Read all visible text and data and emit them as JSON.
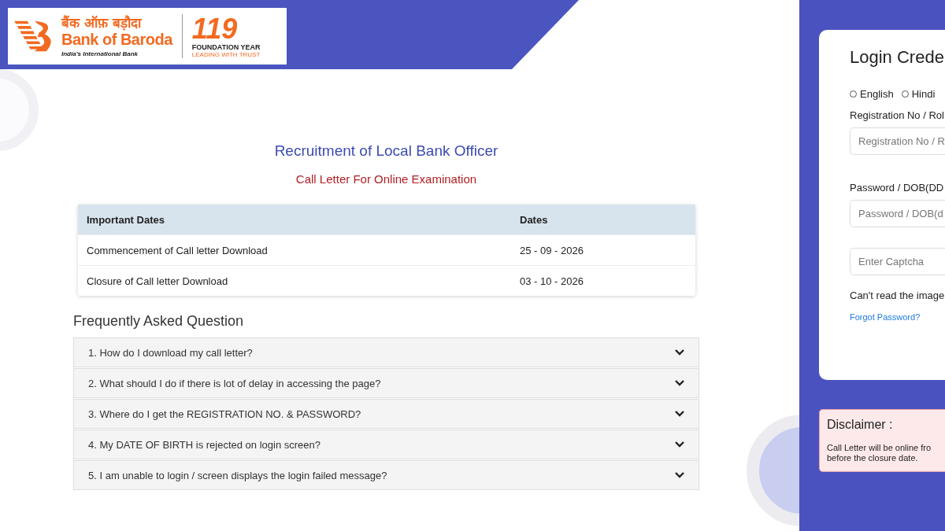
{
  "logo": {
    "hindi_name": "बैंक ऑफ़ बड़ौदा",
    "name": "Bank of Baroda",
    "tagline": "India's International Bank",
    "anniversary": "119",
    "anniversary_caption": "FOUNDATION YEAR",
    "anniversary_tagline": "LEADING WITH TRUST"
  },
  "heading": "Recruitment of Local Bank Officer",
  "subheading": "Call Letter For Online Examination",
  "dates_table": {
    "columns": [
      "Important Dates",
      "Dates"
    ],
    "rows": [
      {
        "event": "Commencement of Call letter Download",
        "date": "25 - 09 - 2026"
      },
      {
        "event": "Closure of Call letter Download",
        "date": "03 - 10 - 2026"
      }
    ]
  },
  "faq": {
    "title": "Frequently Asked Question",
    "items": [
      {
        "question": "1. How do I download my call letter?",
        "expanded": false
      },
      {
        "question": "2. What should I do if there is lot of delay in accessing the page?",
        "expanded": false
      },
      {
        "question": "3. Where do I get the REGISTRATION NO. & PASSWORD?",
        "expanded": false
      },
      {
        "question": "4. My DATE OF BIRTH is rejected on login screen?",
        "expanded": false
      },
      {
        "question": "5. I am unable to login / screen displays the login failed message?",
        "expanded": false
      }
    ]
  },
  "login": {
    "title": "Login Crede",
    "languages": [
      {
        "label": "English",
        "selected": false
      },
      {
        "label": "Hindi",
        "selected": false
      }
    ],
    "fields": [
      {
        "label": "Registration No / Rol",
        "placeholder": "Registration No / R"
      },
      {
        "label": "Password / DOB(DD",
        "placeholder": "Password / DOB(d"
      },
      {
        "placeholder": "Enter Captcha"
      }
    ],
    "captcha_help": "Can't read the image",
    "forgot_link": "Forgot Password?"
  },
  "disclaimer": {
    "title": "Disclaimer :",
    "lines": [
      "Call Letter will be online fro",
      "before the closure date."
    ]
  }
}
